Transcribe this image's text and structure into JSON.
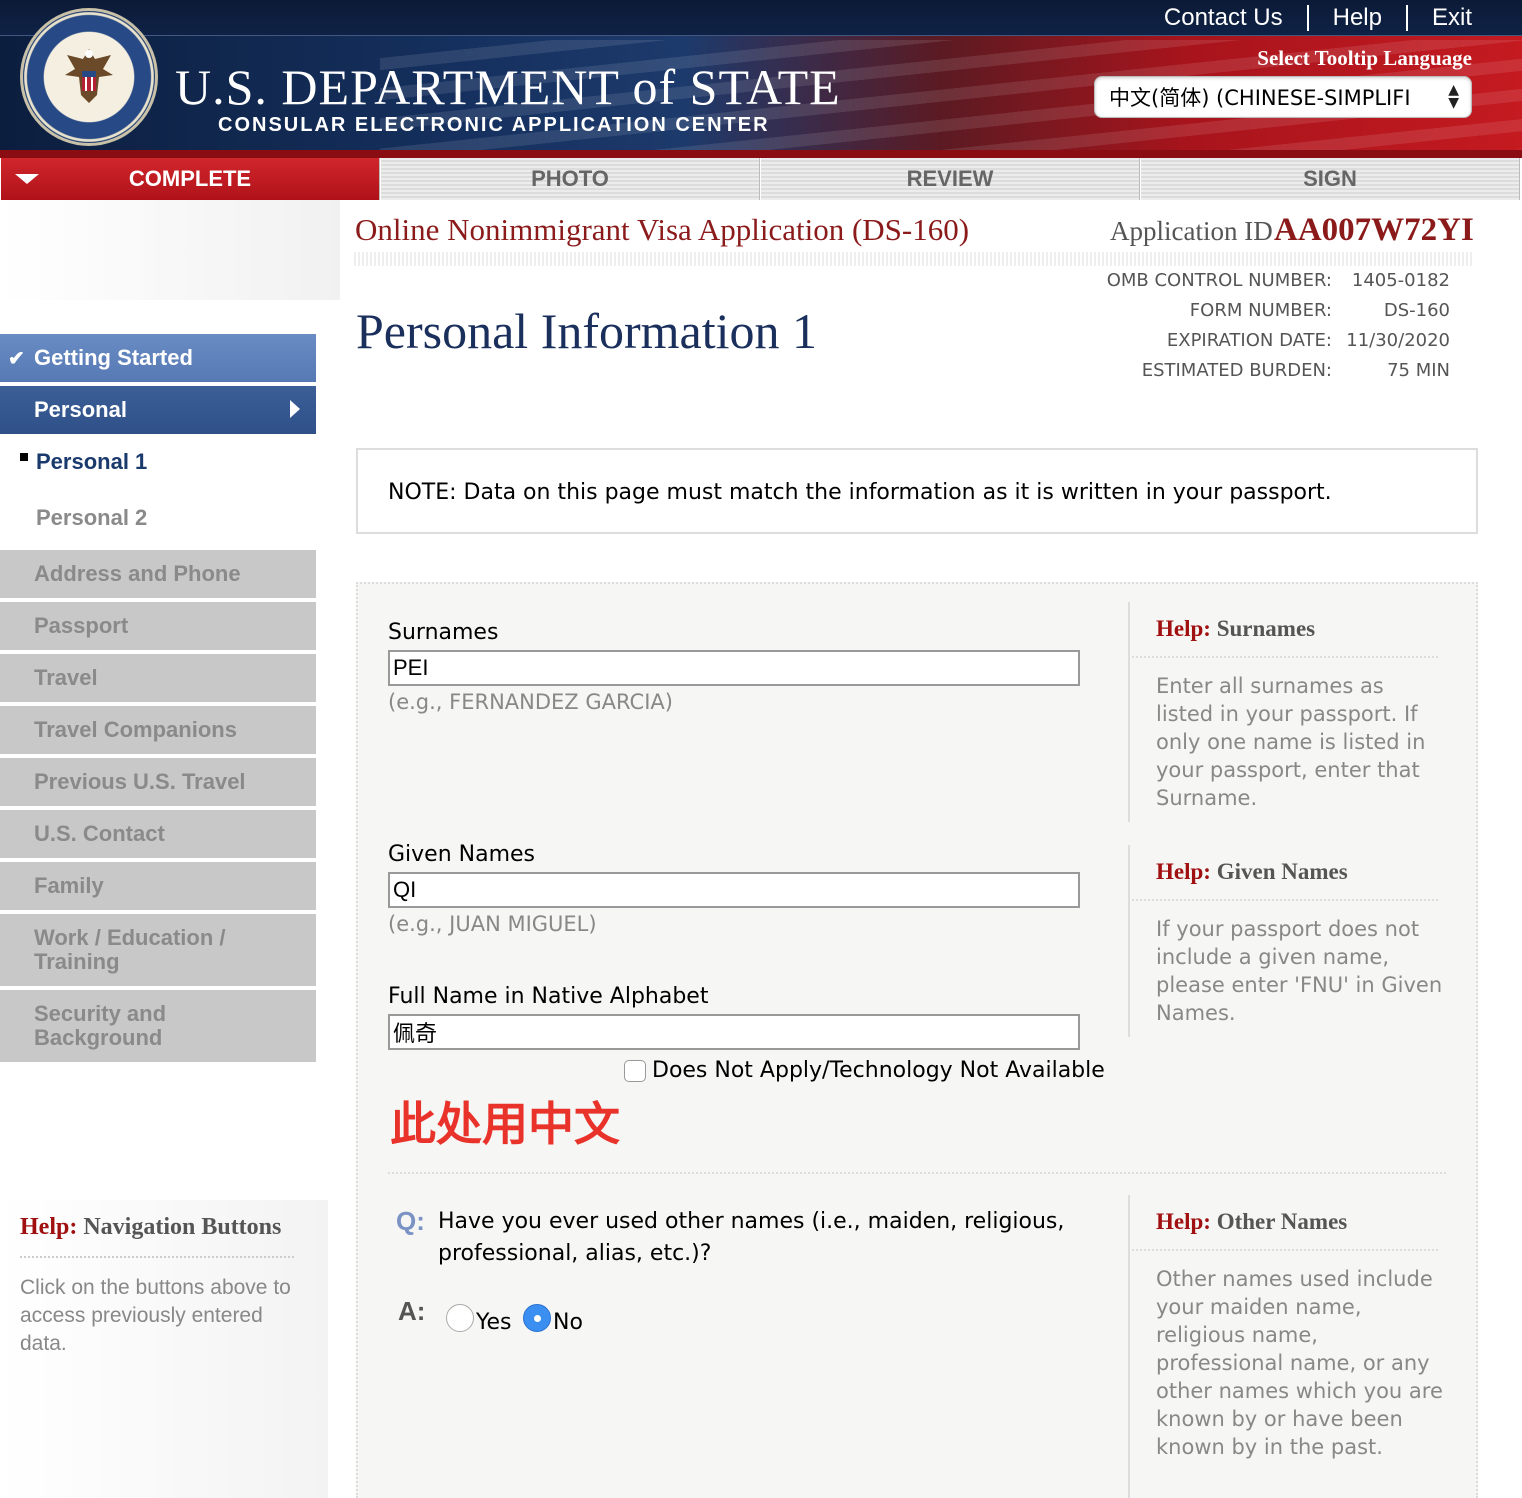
{
  "header": {
    "links": [
      "Contact Us",
      "Help",
      "Exit"
    ],
    "dept_title": "U.S. DEPARTMENT of STATE",
    "dept_subtitle": "CONSULAR ELECTRONIC APPLICATION CENTER",
    "seal_text": "DEPARTMENT OF STATE · UNITED STATES OF AMERICA",
    "tooltip_language_label": "Select Tooltip Language",
    "tooltip_language_value": "中文(简体)  (CHINESE-SIMPLIFI"
  },
  "tabs": [
    {
      "label": "COMPLETE",
      "active": true
    },
    {
      "label": "PHOTO",
      "active": false
    },
    {
      "label": "REVIEW",
      "active": false
    },
    {
      "label": "SIGN",
      "active": false
    }
  ],
  "sidebar": {
    "items": [
      {
        "label": "Getting Started",
        "state": "done"
      },
      {
        "label": "Personal",
        "state": "open"
      },
      {
        "label": "Personal 1",
        "state": "current"
      },
      {
        "label": "Personal 2",
        "state": "sub"
      },
      {
        "label": "Address and Phone",
        "state": "locked"
      },
      {
        "label": "Passport",
        "state": "locked"
      },
      {
        "label": "Travel",
        "state": "locked"
      },
      {
        "label": "Travel Companions",
        "state": "locked"
      },
      {
        "label": "Previous U.S. Travel",
        "state": "locked"
      },
      {
        "label": "U.S. Contact",
        "state": "locked"
      },
      {
        "label": "Family",
        "state": "locked"
      },
      {
        "label": "Work / Education / Training",
        "state": "locked"
      },
      {
        "label": "Security and Background",
        "state": "locked"
      }
    ],
    "help": {
      "prefix": "Help:",
      "title": "Navigation Buttons",
      "body": "Click on the buttons above to access previously entered data."
    }
  },
  "main": {
    "app_title": "Online Nonimmigrant Visa Application (DS-160)",
    "app_id_label": "Application ID",
    "app_id": "AA007W72YI",
    "omb": [
      {
        "label": "OMB CONTROL NUMBER:",
        "value": "1405-0182"
      },
      {
        "label": "FORM NUMBER:",
        "value": "DS-160"
      },
      {
        "label": "EXPIRATION DATE:",
        "value": "11/30/2020"
      },
      {
        "label": "ESTIMATED BURDEN:",
        "value": "75 MIN"
      }
    ],
    "page_title": "Personal Information 1",
    "note": "NOTE: Data on this page must match the information as it is written in your passport."
  },
  "form": {
    "surnames": {
      "label": "Surnames",
      "value": "PEI",
      "hint": "(e.g., FERNANDEZ GARCIA)"
    },
    "given_names": {
      "label": "Given Names",
      "value": "QI",
      "hint": "(e.g., JUAN MIGUEL)"
    },
    "native_name": {
      "label": "Full Name in Native Alphabet",
      "value": "佩奇",
      "na_label": "Does Not Apply/Technology Not Available",
      "na_checked": false
    },
    "annotation": "此处用中文",
    "other_names": {
      "q_label": "Q:",
      "question": "Have you ever used other names (i.e., maiden, religious, professional, alias, etc.)?",
      "a_label": "A:",
      "options": [
        "Yes",
        "No"
      ],
      "selected": "No"
    }
  },
  "help": {
    "prefix": "Help:",
    "surnames": {
      "title": "Surnames",
      "body": "Enter all surnames as listed in your passport. If only one name is listed in your passport, enter that Surname."
    },
    "given_names": {
      "title": "Given Names",
      "body": "If your passport does not include a given name, please enter 'FNU' in Given Names."
    },
    "other_names": {
      "title": "Other Names",
      "body": "Other names used include your maiden name, religious name, professional name, or any other names which you are known by or have been known by in the past."
    }
  },
  "colors": {
    "brand_navy": "#1a2f5c",
    "brand_red": "#8b1a1a",
    "tab_active": "#c41a20",
    "nav_blue": "#5679b4",
    "annotation_red": "#e8322a",
    "radio_selected": "#3b8ff0"
  }
}
